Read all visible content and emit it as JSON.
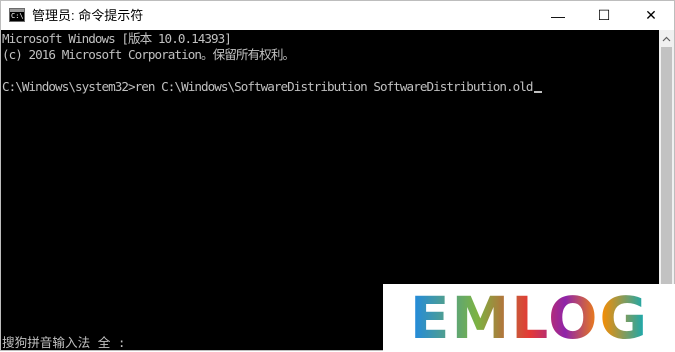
{
  "window": {
    "icon_text": "C:\\",
    "title": "管理员: 命令提示符",
    "minimize_symbol": "—",
    "maximize_symbol": "☐",
    "close_symbol": "✕"
  },
  "console": {
    "lines": [
      "Microsoft Windows [版本 10.0.14393]",
      "(c) 2016 Microsoft Corporation。保留所有权利。",
      "C:\\Windows\\system32>ren C:\\Windows\\SoftwareDistribution SoftwareDistribution.old"
    ],
    "ime_status": "搜狗拼音输入法 全 :"
  },
  "watermark": {
    "text": "EMLOG"
  },
  "colors": {
    "console_bg": "#000000",
    "console_fg": "#c0c0c0",
    "titlebar_bg": "#ffffff",
    "scrollbar_bg": "#f0f0f0"
  }
}
